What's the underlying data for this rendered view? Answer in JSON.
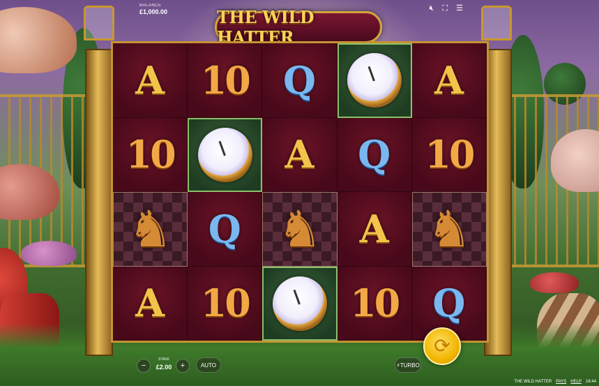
{
  "game": {
    "title": "THE WILD HATTER"
  },
  "balance": {
    "label": "BALANCE",
    "value": "£1,000.00"
  },
  "top_icons": [
    "sound-off-icon",
    "fullscreen-icon",
    "menu-icon"
  ],
  "reels": [
    [
      "A",
      "10",
      "Q",
      "watch",
      "A"
    ],
    [
      "10",
      "watch",
      "A",
      "Q",
      "10"
    ],
    [
      "knight",
      "Q",
      "knight",
      "A",
      "knight"
    ],
    [
      "A",
      "10",
      "watch",
      "10",
      "Q"
    ]
  ],
  "controls": {
    "stake_label": "STAKE",
    "stake_value": "£2.00",
    "minus": "−",
    "plus": "+",
    "auto": "AUTO",
    "turbo": "TURBO",
    "spin_icon": "spin-icon"
  },
  "footer": {
    "game_name": "THE WILD HATTER",
    "pays": "PAYS",
    "help": "HELP",
    "time": "16:44"
  }
}
